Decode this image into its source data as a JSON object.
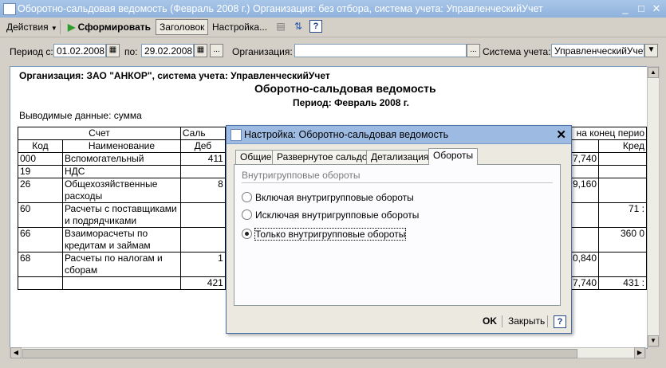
{
  "window": {
    "title": "Оборотно-сальдовая ведомость (Февраль 2008 г.) Организация: без отбора, система учета: УправленческийУчет"
  },
  "toolbar": {
    "actions_label": "Действия",
    "generate_label": "Сформировать",
    "header_label": "Заголовок",
    "settings_label": "Настройка..."
  },
  "params": {
    "period_from_label": "Период с:",
    "period_from": "01.02.2008",
    "period_to_label": "по:",
    "period_to": "29.02.2008",
    "ellipsis": "...",
    "org_label": "Организация:",
    "org_value": "",
    "accounting_label": "Система учета:",
    "accounting_value": "УправленческийУчет"
  },
  "report": {
    "org_line": "Организация: ЗАО \"АНКОР\", система учета: УправленческийУчет",
    "title": "Оборотно-сальдовая ведомость",
    "period": "Период: Февраль 2008 г.",
    "output_data": "Выводимые данные: сумма",
    "headers": {
      "account": "Счет",
      "code": "Код",
      "name": "Наименование",
      "opening_partial": "Саль",
      "debit_partial": "Деб",
      "closing_partial": "на конец перио",
      "credit_partial": "Кред"
    },
    "rows": [
      {
        "code": "000",
        "name": "Вспомогательный",
        "d1": "411",
        "d2": "7,740",
        "c2": ""
      },
      {
        "code": "19",
        "name": "НДС",
        "d1": "",
        "d2": "",
        "c2": ""
      },
      {
        "code": "26",
        "name": "Общехозяйственные расходы",
        "d1": "8",
        "d2": "9,160",
        "c2": ""
      },
      {
        "code": "60",
        "name": "Расчеты с поставщиками и подрядчиками",
        "d1": "",
        "d2": "",
        "c2": "71 :"
      },
      {
        "code": "66",
        "name": "Взаиморасчеты по кредитам и займам",
        "d1": "",
        "d2": "",
        "c2": "360 0"
      },
      {
        "code": "68",
        "name": "Расчеты по налогам и сборам",
        "d1": "1",
        "d2": "0,840",
        "c2": ""
      }
    ],
    "total": {
      "d1": "421",
      "d2": "7,740",
      "c2": "431 :"
    }
  },
  "dialog": {
    "title": "Настройка: Оборотно-сальдовая ведомость",
    "tabs": [
      "Общие",
      "Развернутое сальдо",
      "Детализация",
      "Обороты"
    ],
    "group_title": "Внутригрупповые обороты",
    "options": [
      "Включая внутригрупповые обороты",
      "Исключая внутригрупповые обороты",
      "Только внутригрупповые обороты"
    ],
    "selected_option": "Только внутригрупповые обороты",
    "ok_label": "OK",
    "close_label": "Закрыть",
    "help_label": "?"
  },
  "colors": {
    "titlebar": "#a8c6e8",
    "dialog_title": "#9dbbe2",
    "generate_icon": "#2e9d2e"
  }
}
